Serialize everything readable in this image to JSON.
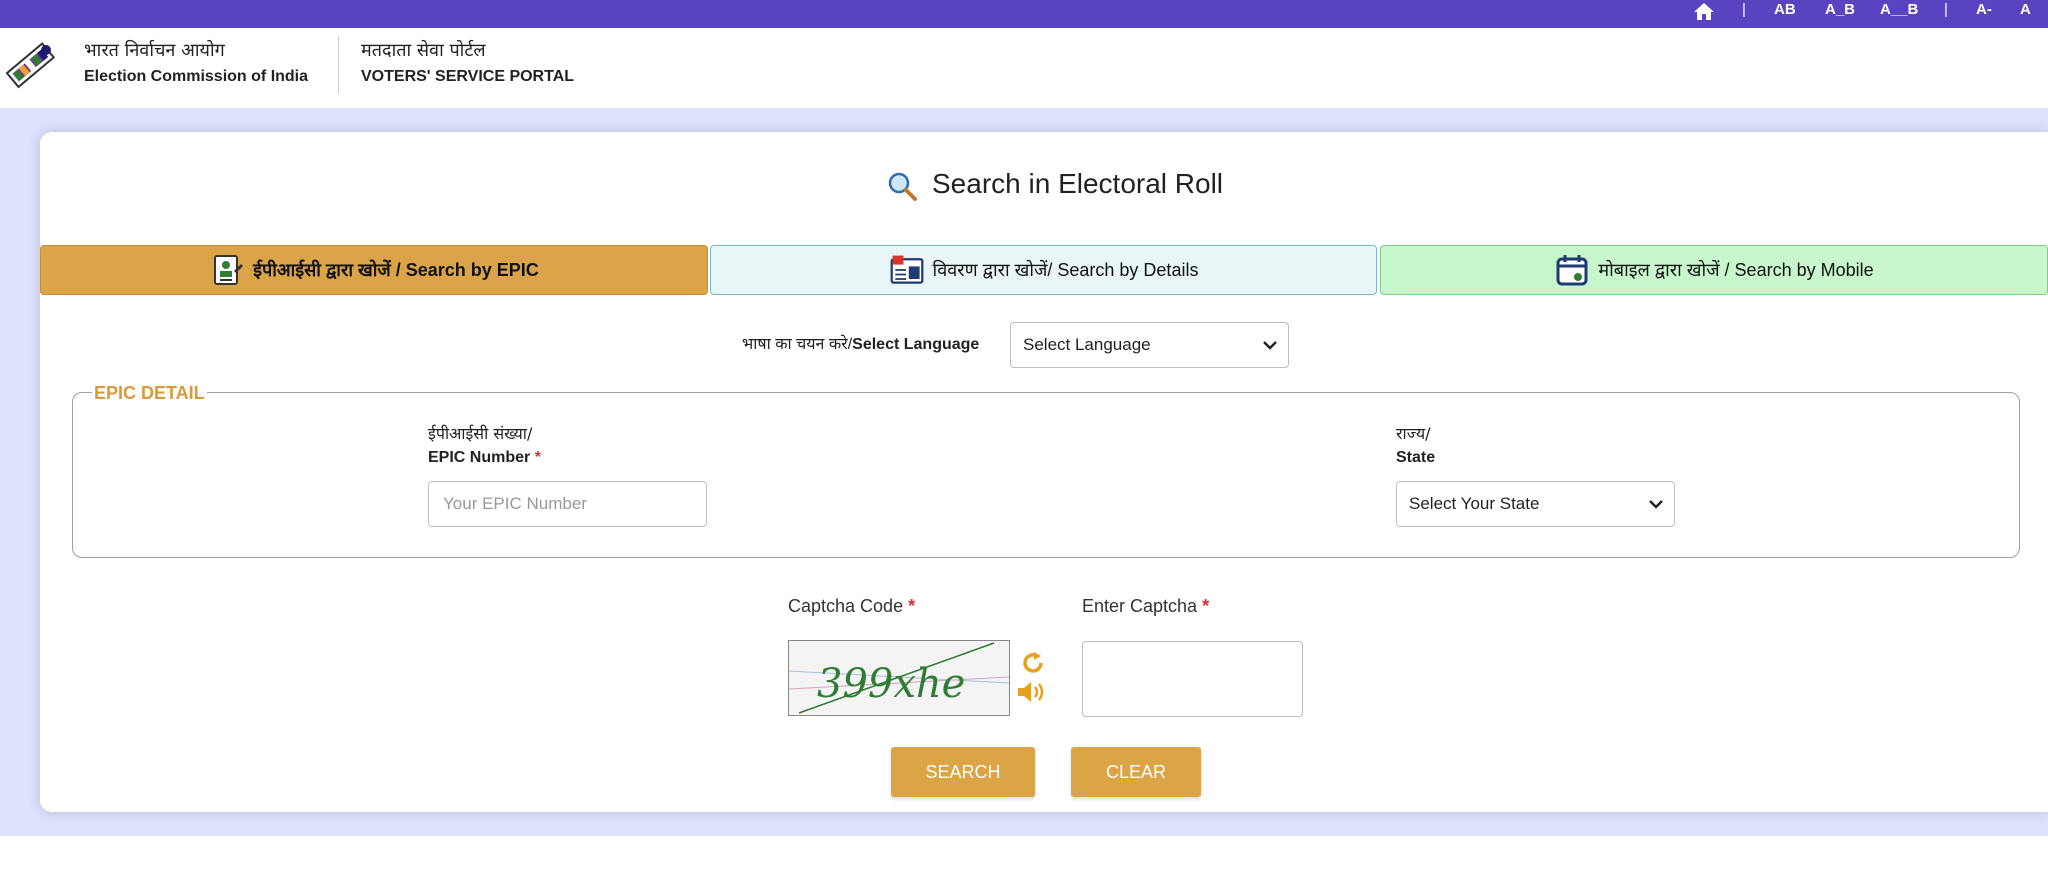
{
  "topbar": {
    "separator": "|",
    "font_sizes": [
      "AB",
      "A_B",
      "A__B"
    ],
    "zoom": [
      "A-",
      "A"
    ]
  },
  "header": {
    "org_hindi": "भारत निर्वाचन आयोग",
    "org_english": "Election Commission of India",
    "portal_hindi": "मतदाता सेवा पोर्टल",
    "portal_english": "VOTERS' SERVICE PORTAL"
  },
  "page": {
    "title": "Search in Electoral Roll"
  },
  "tabs": [
    {
      "label": "ईपीआईसी द्वारा खोजें / Search by EPIC",
      "active": true
    },
    {
      "label": "विवरण द्वारा खोजें/ Search by Details",
      "active": false
    },
    {
      "label": "मोबाइल द्वारा खोजें / Search by Mobile",
      "active": false
    }
  ],
  "language": {
    "label_hindi": "भाषा का चयन करे/",
    "label_english": "Select Language",
    "selected": "Select Language"
  },
  "epic_detail": {
    "legend": "EPIC DETAIL",
    "epic_label_hindi": "ईपीआईसी संख्या/",
    "epic_label_english": "EPIC Number",
    "epic_placeholder": "Your EPIC Number",
    "state_label_hindi": "राज्य/",
    "state_label_english": "State",
    "state_selected": "Select Your State"
  },
  "captcha": {
    "code_label": "Captcha Code",
    "enter_label": "Enter Captcha",
    "required_mark": "*",
    "code_text": "399xhe",
    "enter_value": ""
  },
  "buttons": {
    "search": "SEARCH",
    "clear": "CLEAR"
  },
  "colors": {
    "topbar": "#5a43c0",
    "accent_gold": "#dca448",
    "details_tab": "#e9f6f7",
    "mobile_tab": "#c8f7cc",
    "background": "#dde3fb",
    "required": "#d32f2f"
  }
}
